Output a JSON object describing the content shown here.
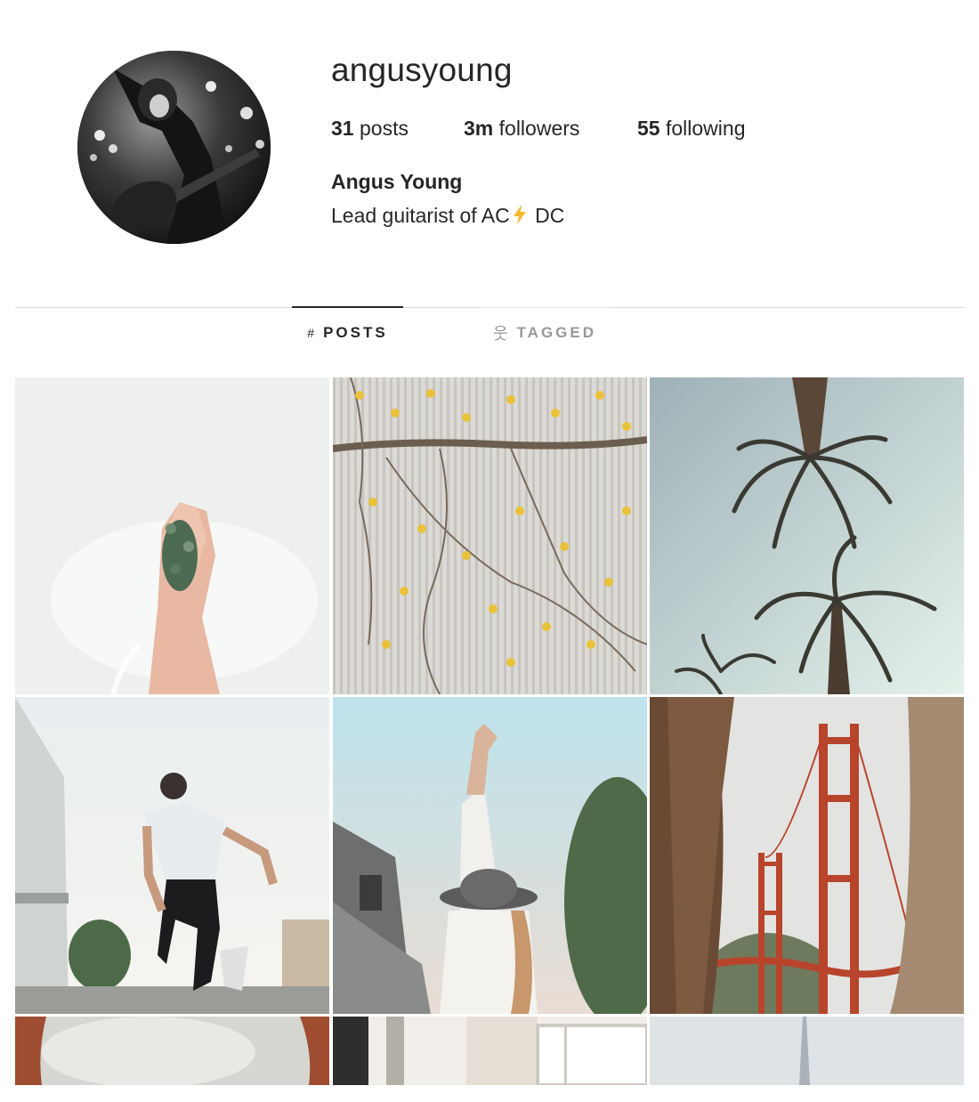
{
  "profile": {
    "username": "angusyoung",
    "stats": [
      {
        "count": "31",
        "label": "posts"
      },
      {
        "count": "3m",
        "label": "followers"
      },
      {
        "count": "55",
        "label": "following"
      }
    ],
    "full_name": "Angus Young",
    "bio_prefix": "Lead guitarist of AC",
    "bio_suffix": " DC"
  },
  "tabs": [
    {
      "icon": "#",
      "label": "POSTS",
      "active": true
    },
    {
      "icon": "웃",
      "label": "TAGGED",
      "active": false
    }
  ],
  "colors": {
    "text": "#262626",
    "muted": "#999999",
    "divider": "#dbdbdb",
    "bolt": "#f5b82e"
  },
  "grid_tiles": [
    {
      "subject": "hand holding plant in water"
    },
    {
      "subject": "yellow flowering vines on ribbed wall"
    },
    {
      "subject": "palm trees against sky"
    },
    {
      "subject": "man jumping outdoors"
    },
    {
      "subject": "woman with hat raising arm"
    },
    {
      "subject": "golden gate bridge between trees"
    },
    {
      "subject": "arch framing cloudy sky"
    },
    {
      "subject": "window interior"
    },
    {
      "subject": "tower in hazy sky"
    }
  ]
}
